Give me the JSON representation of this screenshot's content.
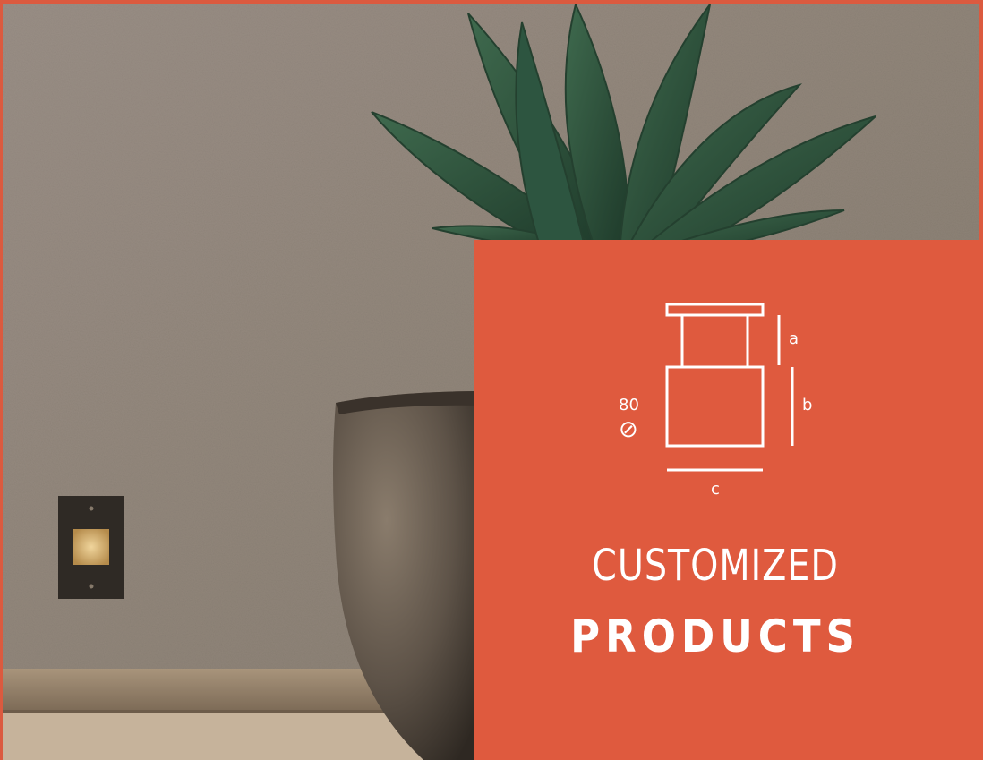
{
  "card": {
    "title_line1": "CUSTOMIZED",
    "title_line2": "PRODUCTS",
    "background_color": "#df5a3e"
  },
  "diagram": {
    "label_a": "a",
    "label_b": "b",
    "label_c": "c",
    "diameter_value": "80",
    "diameter_symbol": "⊘"
  },
  "photo": {
    "subjects": [
      "textured-wall",
      "agave-plant",
      "stone-planter",
      "recessed-wall-light",
      "stone-baseboard"
    ]
  }
}
